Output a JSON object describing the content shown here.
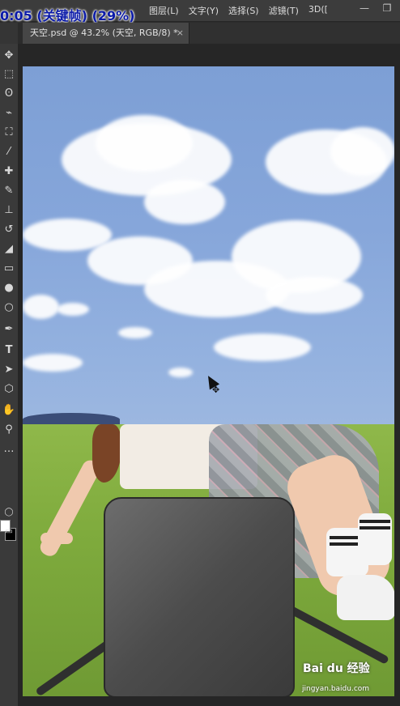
{
  "overlay": {
    "timer_text": "0:05 (关键帧) (29%)"
  },
  "menubar": {
    "items": [
      "图层(L)",
      "文字(Y)",
      "选择(S)",
      "滤镜(T)",
      "3D(["
    ],
    "minimize": "—",
    "restore": "❐"
  },
  "document_tab": {
    "title": "天空.psd @ 43.2% (天空, RGB/8) *",
    "close": "×"
  },
  "tools": [
    {
      "icon": "move-tool-icon",
      "glyph": "✥"
    },
    {
      "icon": "marquee-tool-icon",
      "glyph": "⬚"
    },
    {
      "icon": "lasso-tool-icon",
      "glyph": "ʘ"
    },
    {
      "icon": "quick-select-tool-icon",
      "glyph": "⌁"
    },
    {
      "icon": "crop-tool-icon",
      "glyph": "⛶"
    },
    {
      "icon": "eyedropper-tool-icon",
      "glyph": "⁄"
    },
    {
      "icon": "healing-brush-tool-icon",
      "glyph": "✚"
    },
    {
      "icon": "brush-tool-icon",
      "glyph": "✎"
    },
    {
      "icon": "stamp-tool-icon",
      "glyph": "⊥"
    },
    {
      "icon": "history-brush-tool-icon",
      "glyph": "↺"
    },
    {
      "icon": "eraser-tool-icon",
      "glyph": "◢"
    },
    {
      "icon": "gradient-tool-icon",
      "glyph": "▭"
    },
    {
      "icon": "blur-tool-icon",
      "glyph": "●"
    },
    {
      "icon": "dodge-tool-icon",
      "glyph": "○"
    },
    {
      "icon": "pen-tool-icon",
      "glyph": "✒"
    },
    {
      "icon": "type-tool-icon",
      "glyph": "T"
    },
    {
      "icon": "path-select-tool-icon",
      "glyph": "➤"
    },
    {
      "icon": "shape-tool-icon",
      "glyph": "⬡"
    },
    {
      "icon": "hand-tool-icon",
      "glyph": "✋"
    },
    {
      "icon": "zoom-tool-icon",
      "glyph": "⚲"
    },
    {
      "icon": "more-tools-icon",
      "glyph": "…"
    }
  ],
  "watermark": {
    "brand": "Bai du 经验",
    "url": "jingyan.baidu.com"
  },
  "colors": {
    "foreground": "#ffffff",
    "background": "#000000",
    "accent_overlay": "#0a1aa8"
  }
}
